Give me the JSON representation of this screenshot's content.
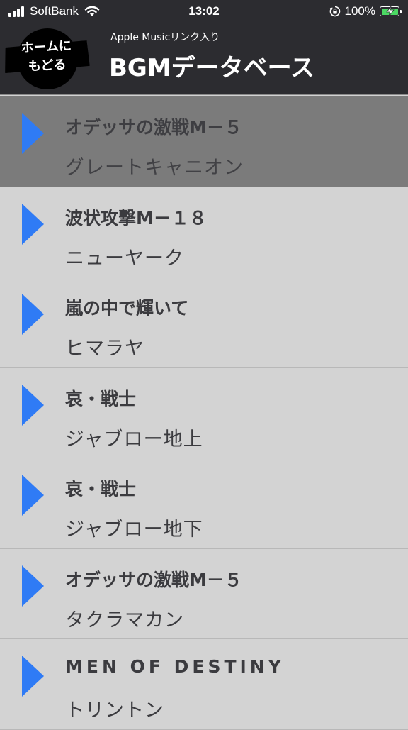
{
  "status": {
    "carrier": "SoftBank",
    "time": "13:02",
    "battery": "100%",
    "battery_level": 1.0,
    "icons": [
      "signal-icon",
      "wifi-icon",
      "rotation-lock-icon",
      "battery-charging-icon"
    ]
  },
  "header": {
    "home_label": "ホームに\nもどる",
    "subtitle": "Apple Musicリンク入り",
    "title": "BGMデータベース"
  },
  "colors": {
    "header_bg": "#2c2c30",
    "list_bg": "#d3d3d3",
    "selected_bg": "#7b7b7b",
    "play_icon": "#2f7bf5",
    "text": "#3b3b3f"
  },
  "tracks": [
    {
      "title": "オデッサの激戦M－５",
      "place": "グレートキャニオン",
      "selected": true
    },
    {
      "title": "波状攻撃M－１８",
      "place": "ニューヤーク",
      "selected": false
    },
    {
      "title": "嵐の中で輝いて",
      "place": "ヒマラヤ",
      "selected": false
    },
    {
      "title": "哀・戦士",
      "place": "ジャブロー地上",
      "selected": false
    },
    {
      "title": "哀・戦士",
      "place": "ジャブロー地下",
      "selected": false
    },
    {
      "title": "オデッサの激戦M－５",
      "place": "タクラマカン",
      "selected": false
    },
    {
      "title": "MEN OF DESTINY",
      "place": "トリントン",
      "selected": false
    }
  ]
}
